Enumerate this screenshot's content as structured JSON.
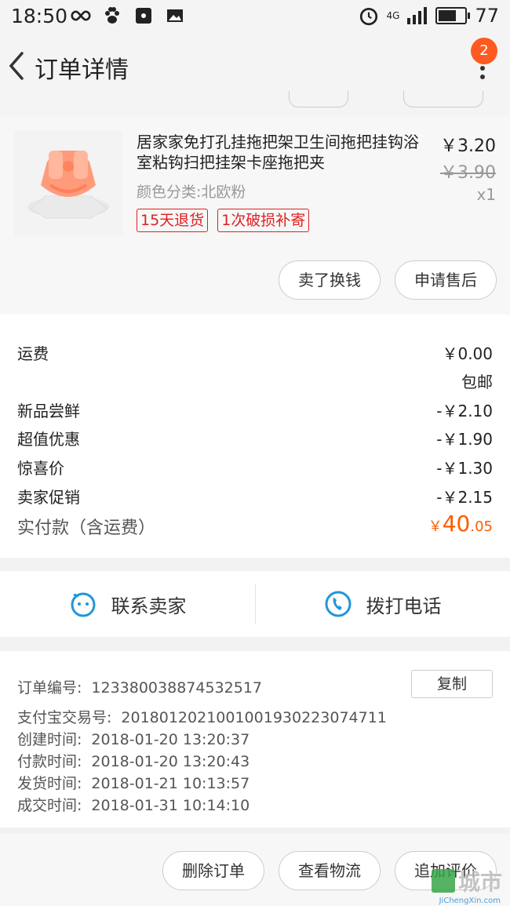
{
  "status_bar": {
    "time": "18:50",
    "network": "4G",
    "battery": "77"
  },
  "header": {
    "title": "订单详情",
    "badge": "2"
  },
  "product": {
    "title": "居家家免打孔挂拖把架卫生间拖把挂钩浴室粘钩扫把挂架卡座拖把夹",
    "sku": "颜色分类:北欧粉",
    "tags": [
      "15天退货",
      "1次破损补寄"
    ],
    "price": "￥3.20",
    "original_price": "￥3.90",
    "quantity": "x1",
    "actions": [
      "卖了换钱",
      "申请售后"
    ]
  },
  "fees": {
    "shipping_label": "运费",
    "shipping_value": "￥0.00",
    "shipping_note": "包邮",
    "rows": [
      {
        "label": "新品尝鲜",
        "value": "-￥2.10"
      },
      {
        "label": "超值优惠",
        "value": "-￥1.90"
      },
      {
        "label": "惊喜价",
        "value": "-￥1.30"
      },
      {
        "label": "卖家促销",
        "value": "-￥2.15"
      }
    ],
    "total_label": "实付款（含运费）",
    "total_currency": "￥",
    "total_integer": "40",
    "total_decimal": ".05"
  },
  "contact": {
    "seller": "联系卖家",
    "phone": "拨打电话"
  },
  "order_info": {
    "order_no_label": "订单编号:",
    "order_no": "123380038874532517",
    "copy": "复制",
    "alipay_label": "支付宝交易号:",
    "alipay_no": "2018012021001001930223074711",
    "created_label": "创建时间:",
    "created": "2018-01-20 13:20:37",
    "paid_label": "付款时间:",
    "paid": "2018-01-20 13:20:43",
    "shipped_label": "发货时间:",
    "shipped": "2018-01-21 10:13:57",
    "completed_label": "成交时间:",
    "completed": "2018-01-31 10:14:10"
  },
  "bottom_actions": [
    "删除订单",
    "查看物流",
    "追加评价"
  ],
  "watermark": {
    "text": "城市",
    "sub": "JiChengXin.com"
  },
  "colors": {
    "accent": "#ff5a00",
    "tag_red": "#e02020",
    "link_blue": "#2196d8"
  }
}
